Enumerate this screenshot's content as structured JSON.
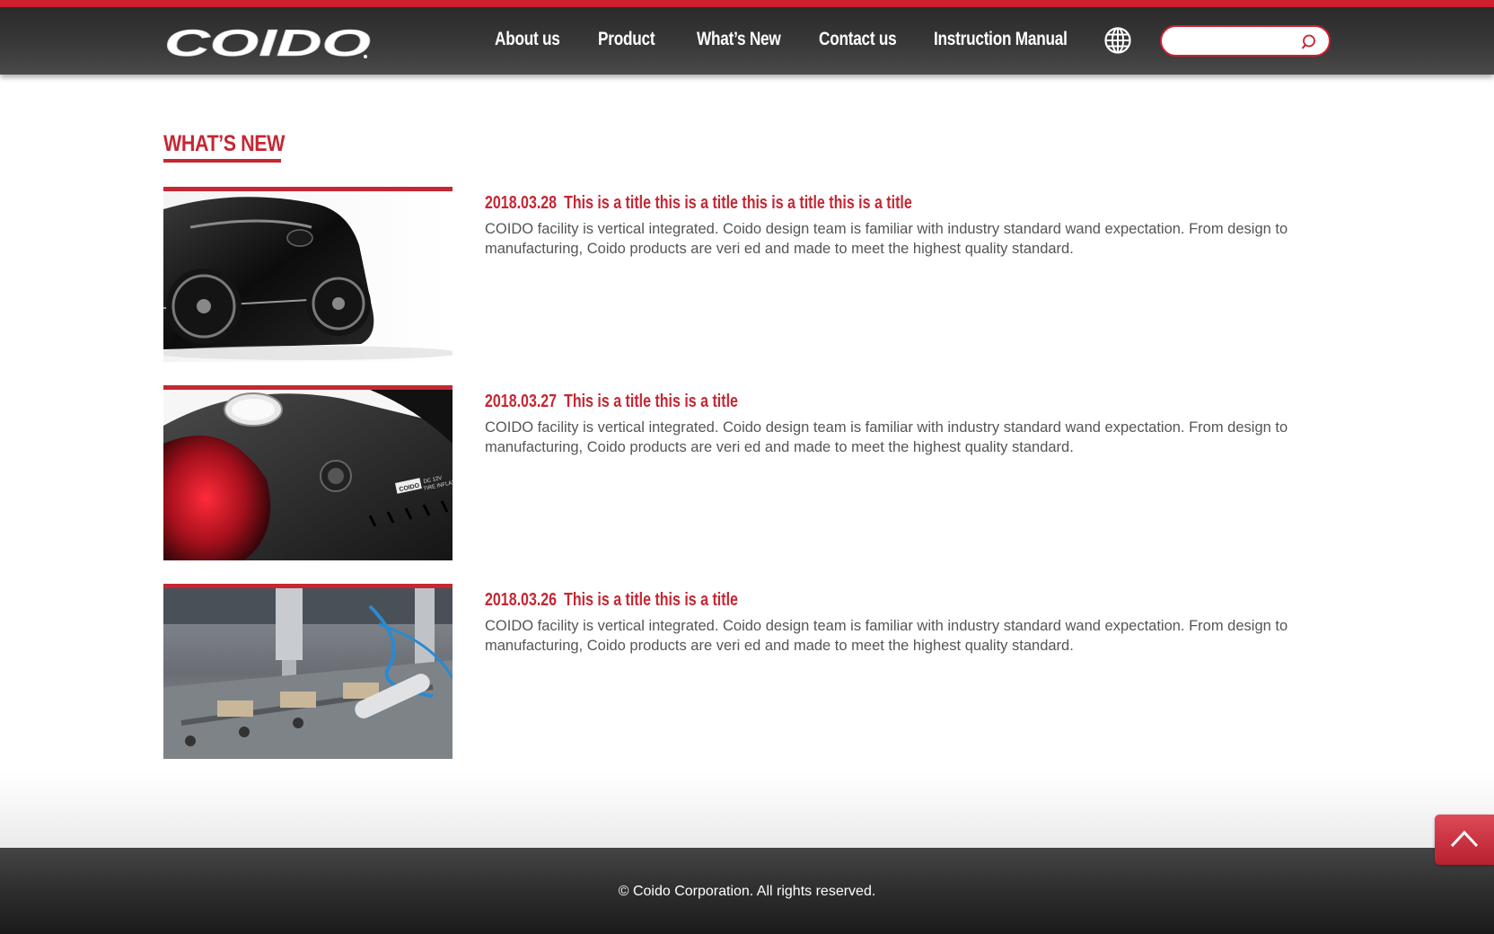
{
  "brand": {
    "logo_text": "COIDO",
    "accent_color": "#c52733",
    "topline_color": "#d0202e"
  },
  "nav": {
    "items": [
      {
        "label": "About us"
      },
      {
        "label": "Product"
      },
      {
        "label": "What’s New"
      },
      {
        "label": "Contact us"
      },
      {
        "label": "Instruction Manual"
      }
    ],
    "language_icon": "globe-icon"
  },
  "search": {
    "placeholder": "",
    "value": "",
    "icon": "search-icon"
  },
  "section": {
    "title": "WHAT’S NEW"
  },
  "news": [
    {
      "date": "2018.03.28",
      "title": "This is a title this is a title this is a title this is a title",
      "body": "COIDO facility is vertical integrated. Coido design team is familiar with industry standard wand expectation. From design to manufacturing, Coido products are veri ed and made to meet the highest quality standard.",
      "image": "car-side-photo"
    },
    {
      "date": "2018.03.27",
      "title": "This is a title this is a title",
      "body": "COIDO facility is vertical integrated. Coido design team is familiar with industry standard wand expectation. From design to manufacturing, Coido products are veri ed and made to meet the highest quality standard.",
      "image": "tire-inflator-photo",
      "image_text": "COIDO DC 12V TIRE INFLAT"
    },
    {
      "date": "2018.03.26",
      "title": "This is a title this is a title",
      "body": "COIDO facility is vertical integrated. Coido design team is familiar with industry standard wand expectation. From design to manufacturing, Coido products are veri ed and made to meet the highest quality standard.",
      "image": "factory-machinery-photo"
    }
  ],
  "footer": {
    "copyright": "© Coido Corporation. All rights reserved."
  },
  "back_to_top": {
    "icon": "chevron-up-icon"
  }
}
